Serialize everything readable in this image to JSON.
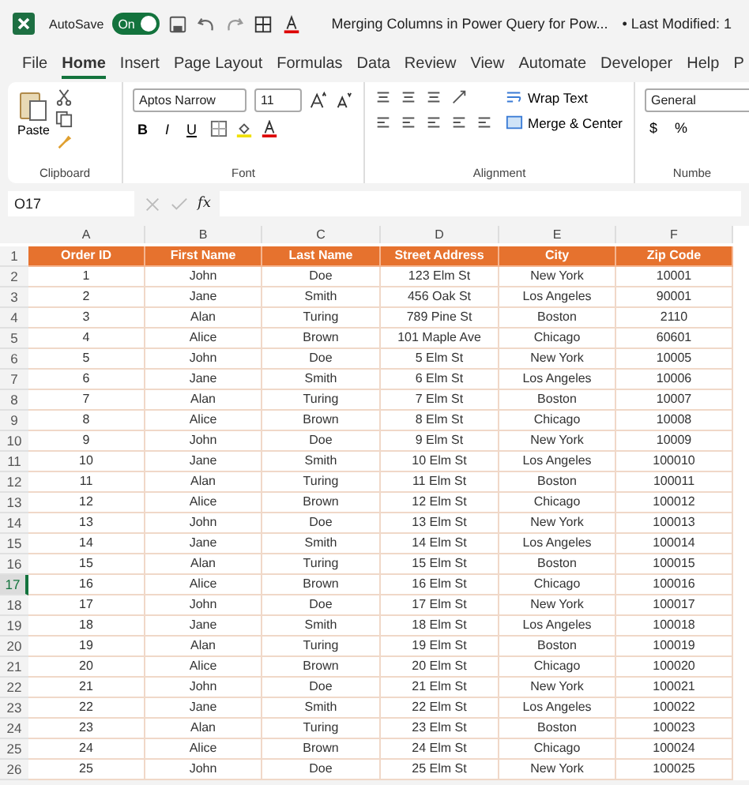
{
  "title_bar": {
    "autosave_label": "AutoSave",
    "autosave": {
      "label": "On",
      "on": true
    },
    "title": "Merging Columns in Power Query for Pow...",
    "modified": "• Last Modified: 1"
  },
  "tabs": [
    {
      "label": "File",
      "selected": false
    },
    {
      "label": "Home",
      "selected": true
    },
    {
      "label": "Insert",
      "selected": false
    },
    {
      "label": "Page Layout",
      "selected": false
    },
    {
      "label": "Formulas",
      "selected": false
    },
    {
      "label": "Data",
      "selected": false
    },
    {
      "label": "Review",
      "selected": false
    },
    {
      "label": "View",
      "selected": false
    },
    {
      "label": "Automate",
      "selected": false
    },
    {
      "label": "Developer",
      "selected": false
    },
    {
      "label": "Help",
      "selected": false
    },
    {
      "label": "P",
      "selected": false
    }
  ],
  "ribbon": {
    "paste": "Paste",
    "font_name": "Aptos Narrow",
    "font_size": "11",
    "bold": "B",
    "italic": "I",
    "underline": "U",
    "wrap_text": "Wrap Text",
    "merge_center": "Merge & Center",
    "number_format": "General",
    "currency": "$",
    "percent": "%",
    "groups": [
      "Clipboard",
      "Font",
      "Alignment",
      "Numbe"
    ]
  },
  "formula_bar": {
    "name_box": "O17",
    "fx": "fx"
  },
  "columns": [
    "A",
    "B",
    "C",
    "D",
    "E",
    "F"
  ],
  "header_row": {
    "number": "1",
    "cells": [
      "Order ID",
      "First Name",
      "Last Name",
      "Street Address",
      "City",
      "Zip Code"
    ]
  },
  "rows": [
    {
      "number": "2",
      "selected": false,
      "cells": [
        "1",
        "John",
        "Doe",
        "123 Elm St",
        "New York",
        "10001"
      ]
    },
    {
      "number": "3",
      "selected": false,
      "cells": [
        "2",
        "Jane",
        "Smith",
        "456 Oak St",
        "Los Angeles",
        "90001"
      ]
    },
    {
      "number": "4",
      "selected": false,
      "cells": [
        "3",
        "Alan",
        "Turing",
        "789 Pine St",
        "Boston",
        "2110"
      ]
    },
    {
      "number": "5",
      "selected": false,
      "cells": [
        "4",
        "Alice",
        "Brown",
        "101 Maple Ave",
        "Chicago",
        "60601"
      ]
    },
    {
      "number": "6",
      "selected": false,
      "cells": [
        "5",
        "John",
        "Doe",
        "5 Elm St",
        "New York",
        "10005"
      ]
    },
    {
      "number": "7",
      "selected": false,
      "cells": [
        "6",
        "Jane",
        "Smith",
        "6 Elm St",
        "Los Angeles",
        "10006"
      ]
    },
    {
      "number": "8",
      "selected": false,
      "cells": [
        "7",
        "Alan",
        "Turing",
        "7 Elm St",
        "Boston",
        "10007"
      ]
    },
    {
      "number": "9",
      "selected": false,
      "cells": [
        "8",
        "Alice",
        "Brown",
        "8 Elm St",
        "Chicago",
        "10008"
      ]
    },
    {
      "number": "10",
      "selected": false,
      "cells": [
        "9",
        "John",
        "Doe",
        "9 Elm St",
        "New York",
        "10009"
      ]
    },
    {
      "number": "11",
      "selected": false,
      "cells": [
        "10",
        "Jane",
        "Smith",
        "10 Elm St",
        "Los Angeles",
        "100010"
      ]
    },
    {
      "number": "12",
      "selected": false,
      "cells": [
        "11",
        "Alan",
        "Turing",
        "11 Elm St",
        "Boston",
        "100011"
      ]
    },
    {
      "number": "13",
      "selected": false,
      "cells": [
        "12",
        "Alice",
        "Brown",
        "12 Elm St",
        "Chicago",
        "100012"
      ]
    },
    {
      "number": "14",
      "selected": false,
      "cells": [
        "13",
        "John",
        "Doe",
        "13 Elm St",
        "New York",
        "100013"
      ]
    },
    {
      "number": "15",
      "selected": false,
      "cells": [
        "14",
        "Jane",
        "Smith",
        "14 Elm St",
        "Los Angeles",
        "100014"
      ]
    },
    {
      "number": "16",
      "selected": false,
      "cells": [
        "15",
        "Alan",
        "Turing",
        "15 Elm St",
        "Boston",
        "100015"
      ]
    },
    {
      "number": "17",
      "selected": true,
      "cells": [
        "16",
        "Alice",
        "Brown",
        "16 Elm St",
        "Chicago",
        "100016"
      ]
    },
    {
      "number": "18",
      "selected": false,
      "cells": [
        "17",
        "John",
        "Doe",
        "17 Elm St",
        "New York",
        "100017"
      ]
    },
    {
      "number": "19",
      "selected": false,
      "cells": [
        "18",
        "Jane",
        "Smith",
        "18 Elm St",
        "Los Angeles",
        "100018"
      ]
    },
    {
      "number": "20",
      "selected": false,
      "cells": [
        "19",
        "Alan",
        "Turing",
        "19 Elm St",
        "Boston",
        "100019"
      ]
    },
    {
      "number": "21",
      "selected": false,
      "cells": [
        "20",
        "Alice",
        "Brown",
        "20 Elm St",
        "Chicago",
        "100020"
      ]
    },
    {
      "number": "22",
      "selected": false,
      "cells": [
        "21",
        "John",
        "Doe",
        "21 Elm St",
        "New York",
        "100021"
      ]
    },
    {
      "number": "23",
      "selected": false,
      "cells": [
        "22",
        "Jane",
        "Smith",
        "22 Elm St",
        "Los Angeles",
        "100022"
      ]
    },
    {
      "number": "24",
      "selected": false,
      "cells": [
        "23",
        "Alan",
        "Turing",
        "23 Elm St",
        "Boston",
        "100023"
      ]
    },
    {
      "number": "25",
      "selected": false,
      "cells": [
        "24",
        "Alice",
        "Brown",
        "24 Elm St",
        "Chicago",
        "100024"
      ]
    },
    {
      "number": "26",
      "selected": false,
      "cells": [
        "25",
        "John",
        "Doe",
        "25 Elm St",
        "New York",
        "100025"
      ]
    }
  ]
}
